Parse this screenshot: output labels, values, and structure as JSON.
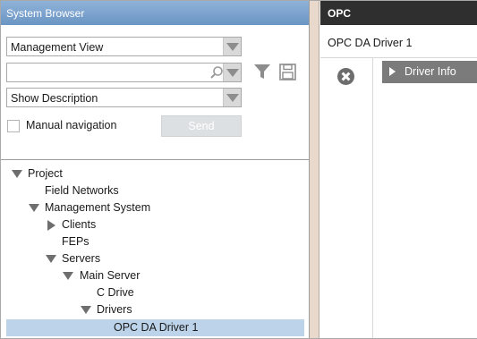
{
  "left_panel": {
    "title": "System Browser",
    "view_select": {
      "value": "Management View"
    },
    "search": {
      "value": "",
      "placeholder": ""
    },
    "description_select": {
      "value": "Show Description"
    },
    "manual_navigation": {
      "label": "Manual navigation",
      "checked": false
    },
    "send_label": "Send",
    "tree": [
      {
        "label": "Project",
        "expander": "expanded",
        "depth": 0
      },
      {
        "label": "Field Networks",
        "expander": "none",
        "depth": 1
      },
      {
        "label": "Management System",
        "expander": "expanded",
        "depth": 1
      },
      {
        "label": "Clients",
        "expander": "collapsed",
        "depth": 2
      },
      {
        "label": "FEPs",
        "expander": "none",
        "depth": 2
      },
      {
        "label": "Servers",
        "expander": "expanded",
        "depth": 2
      },
      {
        "label": "Main Server",
        "expander": "expanded",
        "depth": 3
      },
      {
        "label": "C Drive",
        "expander": "none",
        "depth": 4
      },
      {
        "label": "Drivers",
        "expander": "expanded",
        "depth": 4
      },
      {
        "label": "OPC DA Driver 1",
        "expander": "none",
        "depth": 5,
        "selected": true
      }
    ]
  },
  "right_panel": {
    "header": "OPC",
    "title": "OPC DA Driver 1",
    "section_label": "Driver Info"
  },
  "colors": {
    "left_header": "#6b95c4",
    "right_header": "#2f2f2f",
    "selection": "#bcd3ea",
    "splitter": "#e9d9cc"
  }
}
